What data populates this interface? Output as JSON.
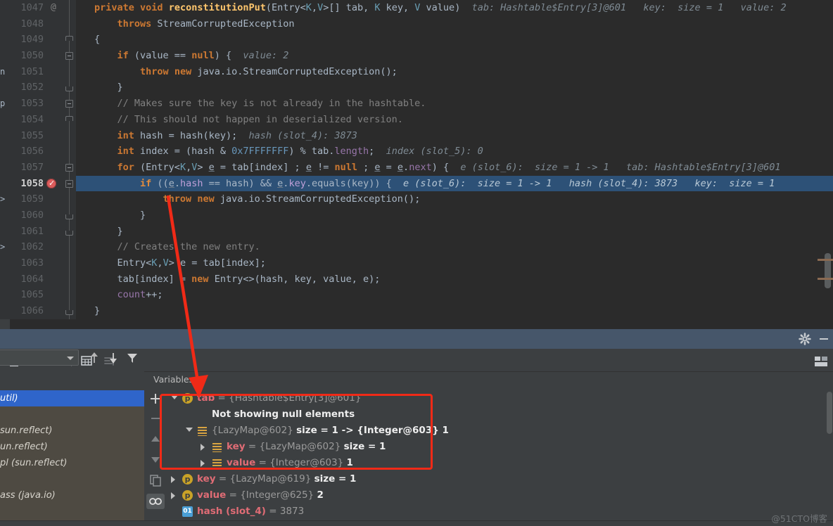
{
  "editor": {
    "lines": [
      {
        "no": "1047",
        "annot": "@",
        "fold": "none",
        "code_html": "<span class=\"kw\">private</span> <span class=\"kw\">void</span> <span class=\"fn\">reconstitutionPut</span>(Entry&lt;<span class=\"gen\">K</span>,<span class=\"gen\">V</span>&gt;[] tab, <span class=\"gen\">K</span> key, <span class=\"gen\">V</span> value)",
        "hint": "tab: Hashtable$Entry[3]@601   key:  size = 1   value: 2",
        "indent": 0
      },
      {
        "no": "1048",
        "annot": "",
        "fold": "none",
        "code_html": "    <span class=\"kw\">throws</span> StreamCorruptedException",
        "hint": "",
        "indent": 0
      },
      {
        "no": "1049",
        "annot": "",
        "fold": "cap",
        "code_html": "{",
        "hint": "",
        "indent": 0
      },
      {
        "no": "1050",
        "annot": "",
        "fold": "open",
        "code_html": "    <span class=\"kw\">if</span> (value == <span class=\"kw\">null</span>) {",
        "hint": "value: 2",
        "indent": 0
      },
      {
        "no": "1051",
        "annot": "",
        "fold": "none",
        "code_html": "        <span class=\"kw\">throw</span> <span class=\"kw\">new</span> java.io.StreamCorruptedException();",
        "hint": "",
        "indent": 0
      },
      {
        "no": "1052",
        "annot": "",
        "fold": "capb",
        "code_html": "    }",
        "hint": "",
        "indent": 0
      },
      {
        "no": "1053",
        "annot": "",
        "fold": "open",
        "code_html": "    <span class=\"cmt\">// Makes sure the key is not already in the hashtable.</span>",
        "hint": "",
        "indent": 0
      },
      {
        "no": "1054",
        "annot": "",
        "fold": "cap",
        "code_html": "    <span class=\"cmt\">// This should not happen in deserialized version.</span>",
        "hint": "",
        "indent": 0
      },
      {
        "no": "1055",
        "annot": "",
        "fold": "none",
        "code_html": "    <span class=\"kw\">int</span> hash = hash(key);",
        "hint": "hash (slot_4): 3873",
        "indent": 0
      },
      {
        "no": "1056",
        "annot": "",
        "fold": "none",
        "code_html": "    <span class=\"kw\">int</span> index = (hash &amp; <span class=\"num\">0x7FFFFFFF</span>) % tab.<span class=\"fld\">length</span>;",
        "hint": "index (slot_5): 0",
        "indent": 0
      },
      {
        "no": "1057",
        "annot": "",
        "fold": "open",
        "code_html": "    <span class=\"kw\">for</span> (Entry&lt;<span class=\"gen\">K</span>,<span class=\"gen\">V</span>&gt; <span class=\"udl\">e</span> = tab[index] ; <span class=\"udl\">e</span> != <span class=\"kw\">null</span> ; <span class=\"udl\">e</span> = <span class=\"udl\">e</span>.<span class=\"fld\">next</span>) {",
        "hint": "e (slot_6):  size = 1 -&gt; 1   tab: Hashtable$Entry[3]@601",
        "indent": 0
      },
      {
        "no": "1058",
        "annot": "",
        "fold": "open",
        "breakpoint": true,
        "current": true,
        "code_html": "        <span class=\"kw\">if</span> ((<span class=\"udl\">e</span>.<span class=\"fld\">hash</span> == hash) &amp;&amp; <span class=\"udl\">e</span>.<span class=\"fld\">key</span>.equals(key)) {",
        "hint": "e (slot_6):  size = 1 -&gt; 1   hash (slot_4): 3873   key:  size = 1",
        "indent": 0
      },
      {
        "no": "1059",
        "annot": "",
        "fold": "none",
        "code_html": "            <span class=\"kw\">throw</span> <span class=\"kw\">new</span> java.io.StreamCorruptedException();",
        "hint": "",
        "indent": 0
      },
      {
        "no": "1060",
        "annot": "",
        "fold": "capb",
        "code_html": "        }",
        "hint": "",
        "indent": 0
      },
      {
        "no": "1061",
        "annot": "",
        "fold": "capb",
        "code_html": "    }",
        "hint": "",
        "indent": 0
      },
      {
        "no": "1062",
        "annot": "",
        "fold": "none",
        "code_html": "    <span class=\"cmt\">// Creates the new entry.</span>",
        "hint": "",
        "indent": 0
      },
      {
        "no": "1063",
        "annot": "",
        "fold": "none",
        "code_html": "    Entry&lt;<span class=\"gen\">K</span>,<span class=\"gen\">V</span>&gt; e = tab[index];",
        "hint": "",
        "indent": 0
      },
      {
        "no": "1064",
        "annot": "",
        "fold": "none",
        "code_html": "    tab[index] = <span class=\"kw\">new</span> Entry&lt;&gt;(hash, key, value, e);",
        "hint": "",
        "indent": 0
      },
      {
        "no": "1065",
        "annot": "",
        "fold": "none",
        "code_html": "    <span class=\"fld\">count</span>++;",
        "hint": "",
        "indent": 0
      },
      {
        "no": "1066",
        "annot": "",
        "fold": "capb",
        "code_html": "}",
        "hint": "",
        "indent": 0
      }
    ],
    "edge_marks": [
      "n",
      "p",
      ">",
      ">"
    ],
    "current_line": "1058",
    "breakpoint_line": "1058"
  },
  "debug_panel": {
    "header_icons": [
      "gear-icon",
      "minimize-icon"
    ],
    "toolbar_icons": [
      "step-out-icon",
      "drop-frame-icon",
      "run-to-cursor-icon",
      "evaluate-expression-icon",
      "mute-breakpoints-icon"
    ],
    "tab_label": "Variables",
    "frames": {
      "select_value": "",
      "rows": [
        {
          "text": "util)",
          "selected": true
        },
        {
          "text": "",
          "selected": false
        },
        {
          "text": "sun.reflect)",
          "selected": false
        },
        {
          "text": "un.reflect)",
          "selected": false
        },
        {
          "text": "pl (sun.reflect)",
          "selected": false
        },
        {
          "text": "",
          "selected": false
        },
        {
          "text": "ass (java.io)",
          "selected": false
        }
      ]
    },
    "watch_icons": [
      "add-watch-icon",
      "remove-watch-icon",
      "move-up-icon",
      "move-down-icon",
      "copy-icon",
      "inspect-icon"
    ],
    "variables": [
      {
        "indent": 0,
        "toggle": "down",
        "icon": "p",
        "name": "tab",
        "eq": " = ",
        "value": "{Hashtable$Entry[3]@601}",
        "extra": "",
        "highlighted": true
      },
      {
        "indent": 1,
        "toggle": "none",
        "icon": "none",
        "name": "",
        "eq": "",
        "value": "",
        "extra": "Not showing null elements",
        "highlighted": true
      },
      {
        "indent": 1,
        "toggle": "down",
        "icon": "list",
        "name": "",
        "eq": "",
        "value": "{LazyMap@602}",
        "extra": "size = 1 -> {Integer@603} 1",
        "highlighted": true
      },
      {
        "indent": 2,
        "toggle": "right",
        "icon": "list",
        "name": "key",
        "eq": " = ",
        "value": "{LazyMap@602}",
        "extra": "size = 1",
        "highlighted": true
      },
      {
        "indent": 2,
        "toggle": "right",
        "icon": "list",
        "name": "value",
        "eq": " = ",
        "value": "{Integer@603} 1",
        "extra": "",
        "highlighted": true
      },
      {
        "indent": 0,
        "toggle": "right",
        "icon": "p",
        "name": "key",
        "eq": " = ",
        "value": "{LazyMap@619}",
        "extra": "size = 1",
        "highlighted": false
      },
      {
        "indent": 0,
        "toggle": "right",
        "icon": "p",
        "name": "value",
        "eq": " = ",
        "value": "{Integer@625} 2",
        "extra": "",
        "highlighted": false
      },
      {
        "indent": 0,
        "toggle": "none",
        "icon": "prim",
        "name": "hash (slot_4)",
        "eq": " = ",
        "value": "3873",
        "extra": "",
        "highlighted": false
      }
    ]
  },
  "annotations": {
    "arrow_color": "#f02a17",
    "box_color": "#f02a17"
  },
  "watermark": "@51CTO博客"
}
